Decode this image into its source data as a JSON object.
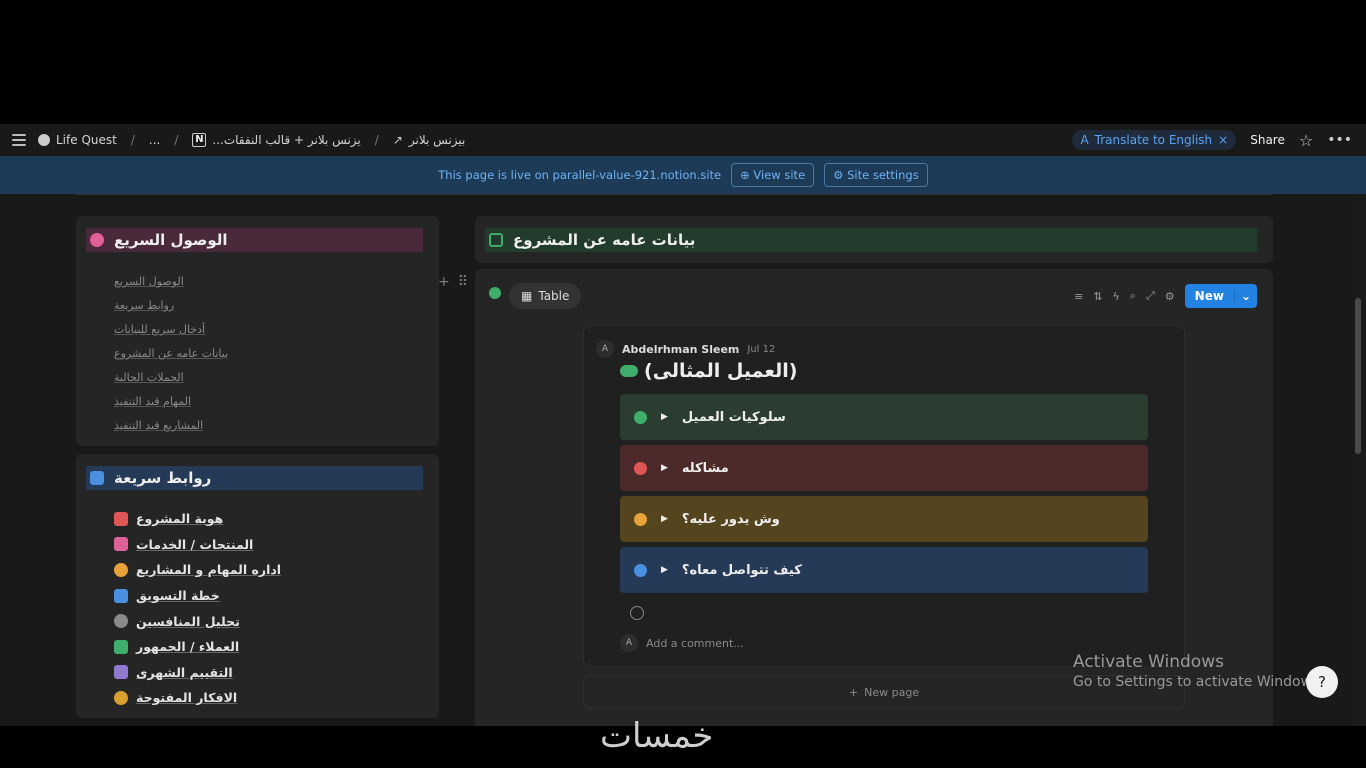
{
  "topbar": {
    "workspace": "Life Quest",
    "ellipsis": "...",
    "crumb_template": "...يزنس بلانر + قالب النفقات",
    "crumb_page": "بيزنس بلانر",
    "translate": "Translate to English",
    "share": "Share"
  },
  "banner": {
    "text": "This page is live on parallel-value-921.notion.site",
    "view_site": "View site",
    "site_settings": "Site settings"
  },
  "quick_access": {
    "title": "الوصول السريع",
    "items": [
      "الوصول السريع",
      "روابط سريعة",
      "أدخال سريع للبيانات",
      "بيانات عامه عن المشروع",
      "الحملات الحالية",
      "المهام قيد التنفيذ",
      "المشاريع قيد التنفيذ"
    ]
  },
  "quick_links": {
    "title": "روابط سريعة",
    "items": [
      {
        "label": "هوية المشروع",
        "icon": "briefcase-icon",
        "color": "#e05555"
      },
      {
        "label": "المنتجات / الخدمات",
        "icon": "sitemap-icon",
        "color": "#e0609a"
      },
      {
        "label": "اداره المهام و المشاريع",
        "icon": "target-icon",
        "color": "#e8a23a"
      },
      {
        "label": "خطة التسويق",
        "icon": "megaphone-icon",
        "color": "#4a8fe0"
      },
      {
        "label": "تحليل المنافسين",
        "icon": "user-icon",
        "color": "#8a8a8a"
      },
      {
        "label": "العملاء / الجمهور",
        "icon": "group-icon",
        "color": "#3fae6a"
      },
      {
        "label": "التقييم الشهرى",
        "icon": "calendar-icon",
        "color": "#8f7ad0"
      },
      {
        "label": "الافكار المفتوحة",
        "icon": "lightbulb-icon",
        "color": "#d8a030"
      }
    ]
  },
  "project_overview": {
    "title": "بيانات عامه عن المشروع"
  },
  "database": {
    "view_tab": "Table",
    "new_button": "New",
    "record": {
      "author": "Abdelrhman Sleem",
      "date": "Jul 12",
      "title": "(العميل المثالى)",
      "toggles": [
        {
          "label": "سلوكيات العميل",
          "bg": "#2a3d30",
          "emo": "#3fae6a"
        },
        {
          "label": "مشاكله",
          "bg": "#4d2a2a",
          "emo": "#e05555"
        },
        {
          "label": "وش يدور عليه؟",
          "bg": "#54451f",
          "emo": "#e8a23a"
        },
        {
          "label": "كيف تتواصل معاه؟",
          "bg": "#253a57",
          "emo": "#4a8fe0"
        }
      ],
      "comment_placeholder": "Add a comment..."
    },
    "new_page": "New page"
  },
  "watermark": {
    "line1": "Activate Windows",
    "line2": "Go to Settings to activate Windows."
  },
  "bottom_logo": "خمسات"
}
